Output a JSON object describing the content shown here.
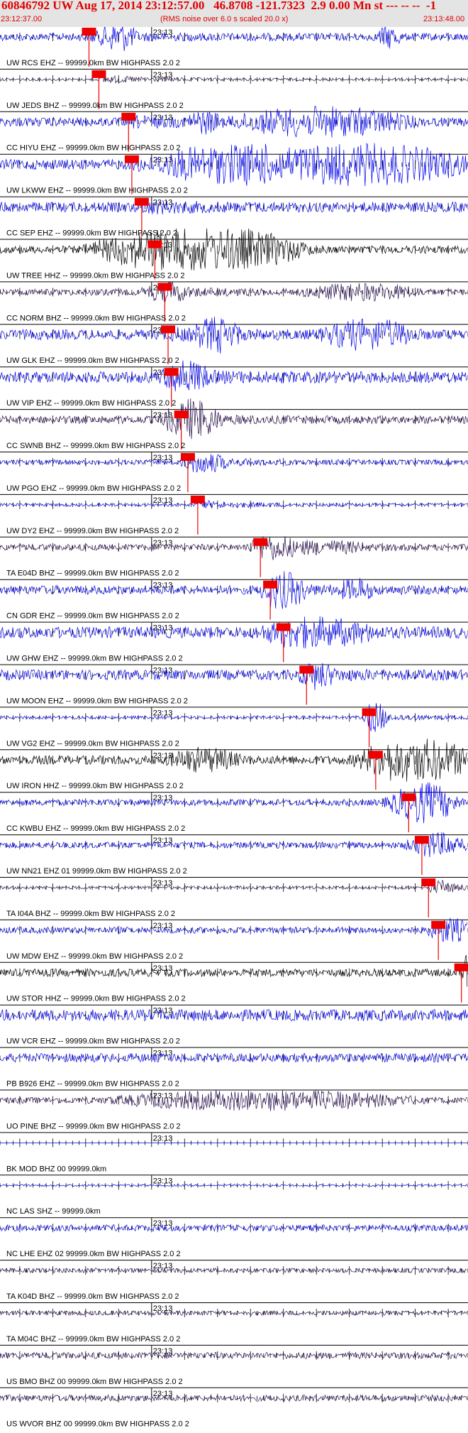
{
  "header": {
    "title": "60846792 UW Aug 17, 2014 23:12:57.00   46.8708 -121.7323  2.9 0.00 Mn st --- -- --  -1",
    "subtitle": "(RMS noise over 6.0 s scaled 20.0 x)",
    "start_time": "23:12:37.00",
    "end_time": "23:13:48.00"
  },
  "chart_data": {
    "type": "line",
    "title": "60846792 UW Aug 17, 2014 23:12:57.00   46.8708 -121.7323  2.9 0.00 Mn st --- -- --  -1",
    "subtitle": "(RMS noise over 6.0 s scaled 20.0 x)",
    "x_range": [
      "23:12:37.00",
      "23:13:48.00"
    ],
    "minute_marker": "23:13",
    "colors": {
      "normal": "#0000ee",
      "accent": "#000000",
      "dark": "#2a1050",
      "pick": "#ee0000",
      "pick_box": "#ee0000"
    },
    "traces": [
      {
        "label": "UW RCS EHZ -- 99999.0km BW  HIGHPASS  2.0  2",
        "pick_s": 13.5,
        "color": "normal",
        "noise": 0.3,
        "bursts": [
          [
            18,
            3,
            0.8
          ],
          [
            59,
            2,
            0.7
          ]
        ]
      },
      {
        "label": "UW JEDS BHZ -- 99999.0km BW  HIGHPASS  2.0  2",
        "pick_s": 15.0,
        "color": "dark",
        "noise": 0.1,
        "bursts": []
      },
      {
        "label": "CC HIYU EHZ -- 99999.0km BW  HIGHPASS  2.0  2",
        "pick_s": 19.5,
        "color": "normal",
        "noise": 0.35,
        "bursts": [
          [
            49,
            15,
            0.9
          ],
          [
            31,
            3,
            0.6
          ]
        ]
      },
      {
        "label": "UW LKWW EHZ -- 99999.0km BW  HIGHPASS  2.0  2",
        "pick_s": 20.0,
        "color": "normal",
        "noise": 0.4,
        "bursts": [
          [
            33,
            10,
            1.1
          ],
          [
            54,
            20,
            1.3
          ]
        ]
      },
      {
        "label": "CC SEP EHZ -- 99999.0km BW  HIGHPASS  2.0  2",
        "pick_s": 21.5,
        "color": "normal",
        "noise": 0.4,
        "bursts": []
      },
      {
        "label": "UW TREE HHZ -- 99999.0km BW  HIGHPASS  2.0  2",
        "pick_s": 23.5,
        "color": "accent",
        "noise": 0.3,
        "bursts": [
          [
            30,
            18,
            1.6
          ],
          [
            75,
            3,
            0.8
          ]
        ]
      },
      {
        "label": "CC NORM BHZ -- 99999.0km BW  HIGHPASS  2.0  2",
        "pick_s": 25.0,
        "color": "dark",
        "noise": 0.25,
        "bursts": [
          [
            25,
            4,
            0.5
          ],
          [
            55,
            10,
            0.5
          ]
        ]
      },
      {
        "label": "UW GLK EHZ -- 99999.0km BW  HIGHPASS  2.0  2",
        "pick_s": 25.5,
        "color": "normal",
        "noise": 0.4,
        "bursts": [
          [
            33,
            4,
            1.0
          ],
          [
            56,
            8,
            0.9
          ]
        ]
      },
      {
        "label": "UW VIP EHZ -- 99999.0km BW  HIGHPASS  2.0  2",
        "pick_s": 26.0,
        "color": "normal",
        "noise": 0.45,
        "bursts": [
          [
            28,
            4,
            0.8
          ]
        ]
      },
      {
        "label": "CC SWNB BHZ -- 99999.0km BW  HIGHPASS  2.0  2",
        "pick_s": 27.5,
        "color": "dark",
        "noise": 0.3,
        "bursts": [
          [
            29,
            5,
            1.2
          ]
        ]
      },
      {
        "label": "UW PGO EHZ -- 99999.0km BW  HIGHPASS  2.0  2",
        "pick_s": 28.5,
        "color": "normal",
        "noise": 0.2,
        "bursts": [
          [
            31,
            4,
            0.5
          ]
        ]
      },
      {
        "label": "UW DY2 EHZ -- 99999.0km BW  HIGHPASS  2.0  2",
        "pick_s": 30.0,
        "color": "normal",
        "noise": 0.12,
        "bursts": []
      },
      {
        "label": "TA E04D BHZ -- 99999.0km BW  HIGHPASS  2.0  2",
        "pick_s": 39.5,
        "color": "dark",
        "noise": 0.25,
        "bursts": [
          [
            41,
            4,
            0.6
          ],
          [
            49,
            8,
            0.3
          ]
        ]
      },
      {
        "label": "CN GDR EHZ -- 99999.0km BW  HIGHPASS  2.0  2",
        "pick_s": 41.0,
        "color": "normal",
        "noise": 0.35,
        "bursts": [
          [
            43,
            4,
            1.0
          ],
          [
            54,
            3,
            0.6
          ]
        ]
      },
      {
        "label": "UW GHW EHZ -- 99999.0km BW  HIGHPASS  2.0  2",
        "pick_s": 43.0,
        "color": "normal",
        "noise": 0.45,
        "bursts": [
          [
            48,
            10,
            0.7
          ]
        ]
      },
      {
        "label": "UW MOON EHZ -- 99999.0km BW  HIGHPASS  2.0  2",
        "pick_s": 46.5,
        "color": "normal",
        "noise": 0.4,
        "bursts": [
          [
            48,
            3,
            0.6
          ]
        ]
      },
      {
        "label": "UW VG2 EHZ -- 99999.0km BW  HIGHPASS  2.0  2",
        "pick_s": 56.0,
        "color": "normal",
        "noise": 0.12,
        "bursts": [
          [
            57,
            2,
            0.9
          ]
        ]
      },
      {
        "label": "UW IRON HHZ -- 99999.0km BW  HIGHPASS  2.0  2",
        "pick_s": 57.0,
        "color": "accent",
        "noise": 0.35,
        "bursts": [
          [
            31,
            6,
            0.7
          ],
          [
            63,
            10,
            1.4
          ]
        ]
      },
      {
        "label": "CC KWBU EHZ -- 99999.0km BW  HIGHPASS  2.0  2",
        "pick_s": 62.0,
        "color": "normal",
        "noise": 0.25,
        "bursts": [
          [
            64,
            6,
            1.2
          ]
        ]
      },
      {
        "label": "UW NN21 EHZ 01 99999.0km BW  HIGHPASS  2.0  2",
        "pick_s": 64.0,
        "color": "normal",
        "noise": 0.25,
        "bursts": [
          [
            66,
            5,
            0.6
          ]
        ]
      },
      {
        "label": "TA I04A BHZ -- 99999.0km BW  HIGHPASS  2.0  2",
        "pick_s": 65.0,
        "color": "dark",
        "noise": 0.12,
        "bursts": [
          [
            67,
            2,
            0.3
          ]
        ]
      },
      {
        "label": "UW MDW EHZ -- 99999.0km BW  HIGHPASS  2.0  2",
        "pick_s": 66.5,
        "color": "normal",
        "noise": 0.25,
        "bursts": [
          [
            68,
            4,
            0.6
          ]
        ]
      },
      {
        "label": "UW STOR HHZ -- 99999.0km BW  HIGHPASS  2.0  2",
        "pick_s": 70.0,
        "color": "accent",
        "noise": 0.3,
        "bursts": [
          [
            72,
            3,
            1.0
          ]
        ]
      },
      {
        "label": "UW VCR EHZ -- 99999.0km BW  HIGHPASS  2.0  2",
        "pick_s": 72.5,
        "color": "normal",
        "noise": 0.45,
        "bursts": [
          [
            80,
            8,
            2.0
          ]
        ]
      },
      {
        "label": "PB B926 EHZ -- 99999.0km BW  HIGHPASS  2.0  2",
        "pick_s": 75.0,
        "color": "normal",
        "noise": 0.35,
        "bursts": [
          [
            78,
            4,
            0.8
          ]
        ]
      },
      {
        "label": "UO PINE BHZ -- 99999.0km BW  HIGHPASS  2.0  2",
        "pick_s": 78.0,
        "color": "dark",
        "noise": 0.25,
        "bursts": [
          [
            40,
            25,
            0.6
          ],
          [
            80,
            6,
            0.9
          ]
        ]
      },
      {
        "label": "BK MOD BHZ 00 99999.0km",
        "pick_s": null,
        "color": "normal",
        "noise": 0,
        "bursts": []
      },
      {
        "label": "NC LAS SHZ -- 99999.0km",
        "pick_s": null,
        "color": "normal",
        "noise": 0.08,
        "bursts": []
      },
      {
        "label": "NC LHE EHZ 02 99999.0km BW  HIGHPASS  2.0  2",
        "pick_s": null,
        "color": "normal",
        "noise": 0.25,
        "bursts": []
      },
      {
        "label": "TA K04D BHZ -- 99999.0km BW  HIGHPASS  2.0  2",
        "pick_s": null,
        "color": "dark",
        "noise": 0.18,
        "bursts": []
      },
      {
        "label": "TA M04C BHZ -- 99999.0km BW  HIGHPASS  2.0  2",
        "pick_s": null,
        "color": "dark",
        "noise": 0.18,
        "bursts": []
      },
      {
        "label": "US BMO BHZ 00 99999.0km BW  HIGHPASS  2.0  2",
        "pick_s": null,
        "color": "dark",
        "noise": 0.25,
        "bursts": []
      },
      {
        "label": "US WVOR BHZ 00 99999.0km BW  HIGHPASS  2.0  2",
        "pick_s": null,
        "color": "dark",
        "noise": 0.25,
        "bursts": []
      }
    ]
  }
}
